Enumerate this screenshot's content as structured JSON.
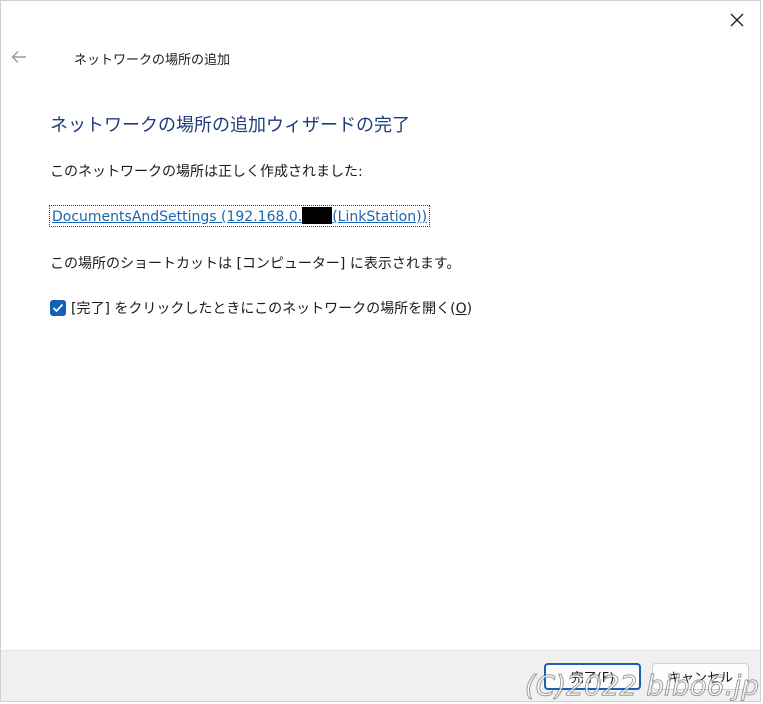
{
  "window": {
    "title": "ネットワークの場所の追加",
    "close_icon": "close-icon",
    "back_icon": "arrow-left-icon"
  },
  "wizard": {
    "heading": "ネットワークの場所の追加ウィザードの完了",
    "success_text": "このネットワークの場所は正しく作成されました:",
    "location_prefix": "DocumentsAndSettings (192.168.0.",
    "location_suffix": "(LinkStation))",
    "shortcut_text": "この場所のショートカットは [コンピューター] に表示されます。",
    "open_checkbox": {
      "label_before": "[完了] をクリックしたときにこのネットワークの場所を開く(",
      "access_key": "O",
      "label_after": ")",
      "checked": true
    }
  },
  "footer": {
    "finish_label": "完了(F)",
    "cancel_label": "キャンセル"
  },
  "watermark": "(C)2022 bibo6.jp",
  "colors": {
    "heading": "#1f3d7a",
    "link": "#1a66b0",
    "checkbox": "#1460b8",
    "footer_bg": "#f0f0f0"
  }
}
